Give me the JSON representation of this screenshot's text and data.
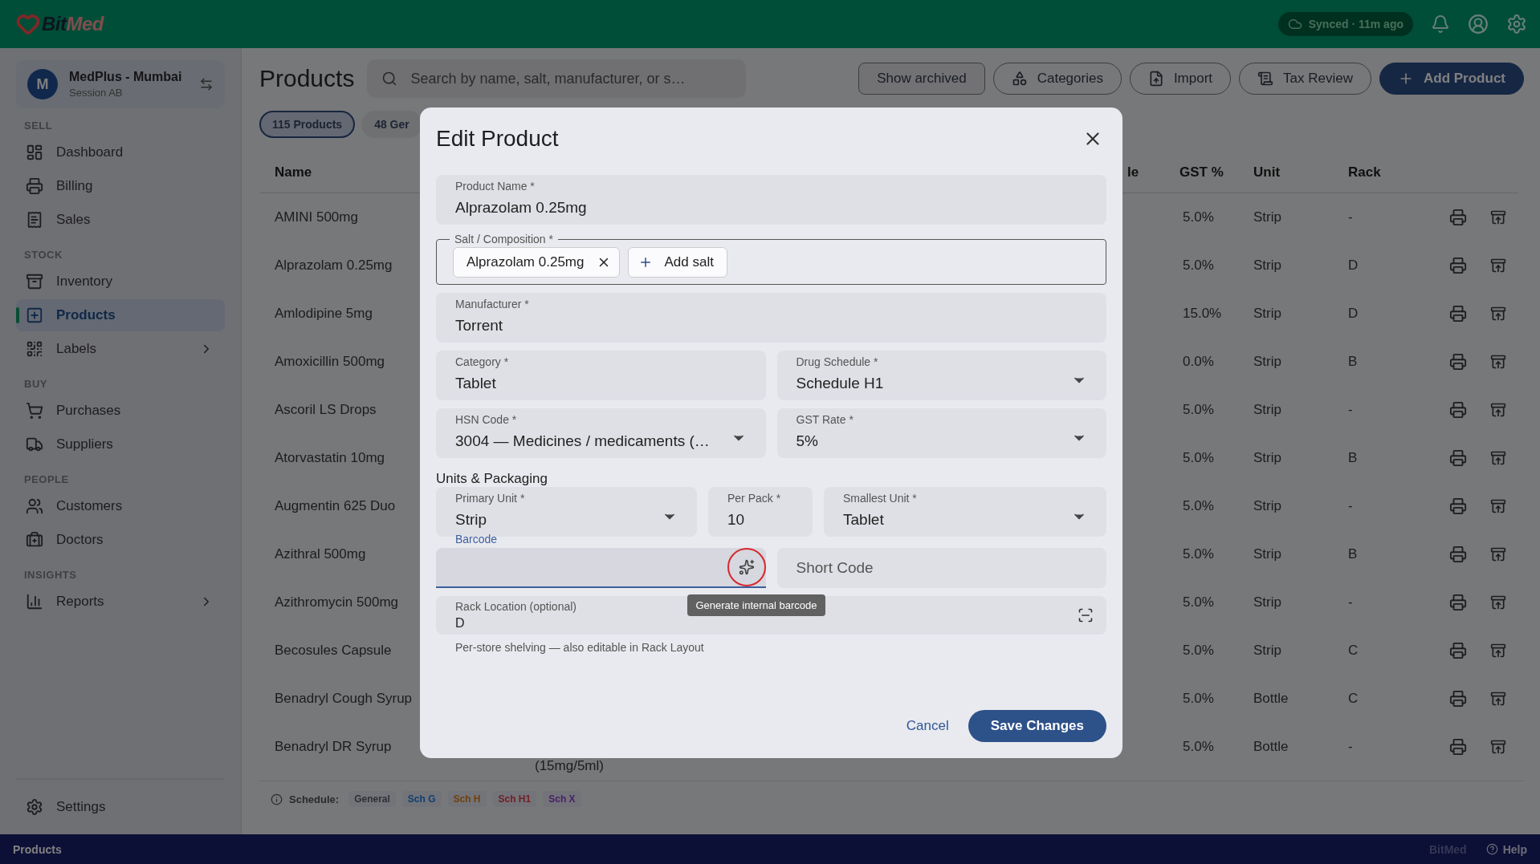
{
  "app": {
    "logo": [
      "Bit",
      "Med"
    ],
    "sync_status": "Synced · 11m ago"
  },
  "sidebar": {
    "store": {
      "avatar": "M",
      "name": "MedPlus - Mumbai",
      "session": "Session AB"
    },
    "sections": [
      {
        "title": "SELL",
        "items": [
          {
            "label": "Dashboard",
            "selected": false
          },
          {
            "label": "Billing",
            "selected": false
          },
          {
            "label": "Sales",
            "selected": false
          }
        ]
      },
      {
        "title": "STOCK",
        "items": [
          {
            "label": "Inventory",
            "selected": false
          },
          {
            "label": "Products",
            "selected": true
          },
          {
            "label": "Labels",
            "selected": false,
            "expanded": false
          }
        ]
      },
      {
        "title": "BUY",
        "items": [
          {
            "label": "Purchases",
            "selected": false
          },
          {
            "label": "Suppliers",
            "selected": false
          }
        ]
      },
      {
        "title": "PEOPLE",
        "items": [
          {
            "label": "Customers",
            "selected": false
          },
          {
            "label": "Doctors",
            "selected": false
          }
        ]
      },
      {
        "title": "INSIGHTS",
        "items": [
          {
            "label": "Reports",
            "selected": false,
            "expanded": false
          }
        ]
      }
    ],
    "settings": "Settings"
  },
  "page": {
    "title": "Products",
    "search_placeholder": "Search by name, salt, manufacturer, or s…",
    "actions": [
      {
        "label": "Show archived",
        "kind": "plain"
      },
      {
        "label": "Categories",
        "kind": "outline"
      },
      {
        "label": "Import",
        "kind": "outline"
      },
      {
        "label": "Tax Review",
        "kind": "outline"
      },
      {
        "label": "Add Product",
        "kind": "primary"
      }
    ],
    "filter_chips": [
      {
        "label": "115 Products",
        "selected": true
      },
      {
        "label": "48 Ger",
        "selected": false
      }
    ]
  },
  "table": {
    "columns": [
      "Name",
      "le",
      "GST %",
      "Unit",
      "Rack"
    ],
    "rows": [
      {
        "name": "AMINI 500mg",
        "gst": "5.0%",
        "unit": "Strip",
        "rack": "-"
      },
      {
        "name": "Alprazolam 0.25mg",
        "gst": "5.0%",
        "unit": "Strip",
        "rack": "D"
      },
      {
        "name": "Amlodipine 5mg",
        "gst": "15.0%",
        "unit": "Strip",
        "rack": "D"
      },
      {
        "name": "Amoxicillin 500mg",
        "gst": "0.0%",
        "unit": "Strip",
        "rack": "B"
      },
      {
        "name": "Ascoril LS Drops",
        "gst": "5.0%",
        "unit": "Strip",
        "rack": "-"
      },
      {
        "name": "Atorvastatin 10mg",
        "gst": "5.0%",
        "unit": "Strip",
        "rack": "B"
      },
      {
        "name": "Augmentin 625 Duo",
        "gst": "5.0%",
        "unit": "Strip",
        "rack": "-"
      },
      {
        "name": "Azithral 500mg",
        "gst": "5.0%",
        "unit": "Strip",
        "rack": "B"
      },
      {
        "name": "Azithromycin 500mg",
        "gst": "5.0%",
        "unit": "Strip",
        "rack": "-"
      },
      {
        "name": "Becosules Capsule",
        "gst": "5.0%",
        "unit": "Strip",
        "rack": "C"
      },
      {
        "name": "Benadryl Cough Syrup",
        "gst": "5.0%",
        "unit": "Bottle",
        "rack": "C"
      },
      {
        "name": "Benadryl DR Syrup",
        "salt": "(15mg/5ml)",
        "gst": "5.0%",
        "unit": "Bottle",
        "rack": "-"
      }
    ]
  },
  "schedule_legend": {
    "label": "Schedule:",
    "chips": [
      {
        "label": "General",
        "color": "#303034"
      },
      {
        "label": "Sch G",
        "color": "#104070"
      },
      {
        "label": "Sch H",
        "color": "#704010"
      },
      {
        "label": "Sch H1",
        "color": "#702028"
      },
      {
        "label": "Sch X",
        "color": "#482068"
      }
    ]
  },
  "status_bar": {
    "page": "Products",
    "brand": "BitMed",
    "help": "Help"
  },
  "modal": {
    "title": "Edit Product",
    "product_name": {
      "label": "Product Name *",
      "value": "Alprazolam 0.25mg"
    },
    "salt": {
      "label": "Salt / Composition *",
      "chips": [
        "Alprazolam 0.25mg"
      ],
      "add_button": "Add salt"
    },
    "manufacturer": {
      "label": "Manufacturer *",
      "value": "Torrent"
    },
    "pairs": [
      [
        {
          "label": "Category *",
          "value": "Tablet",
          "kind": "text"
        },
        {
          "label": "Drug Schedule *",
          "value": "Schedule H1",
          "kind": "select"
        }
      ],
      [
        {
          "label": "HSN Code *",
          "value": "3004 — Medicines / medicaments (…",
          "kind": "select"
        },
        {
          "label": "GST Rate *",
          "value": "5%",
          "kind": "select"
        }
      ]
    ],
    "units_heading": "Units & Packaging",
    "units": [
      {
        "label": "Primary Unit *",
        "value": "Strip",
        "kind": "select"
      },
      {
        "label": "Per Pack *",
        "value": "10",
        "kind": "text"
      },
      {
        "label": "Smallest Unit *",
        "value": "Tablet",
        "kind": "select"
      }
    ],
    "barcode": {
      "label": "Barcode",
      "focused": true,
      "tooltip": "Generate internal barcode"
    },
    "short_code": {
      "placeholder": "Short Code"
    },
    "rack_location": {
      "label": "Rack Location (optional)",
      "value": "D",
      "helper": "Per-store shelving — also editable in Rack Layout"
    },
    "cancel": "Cancel",
    "save": "Save Changes"
  }
}
